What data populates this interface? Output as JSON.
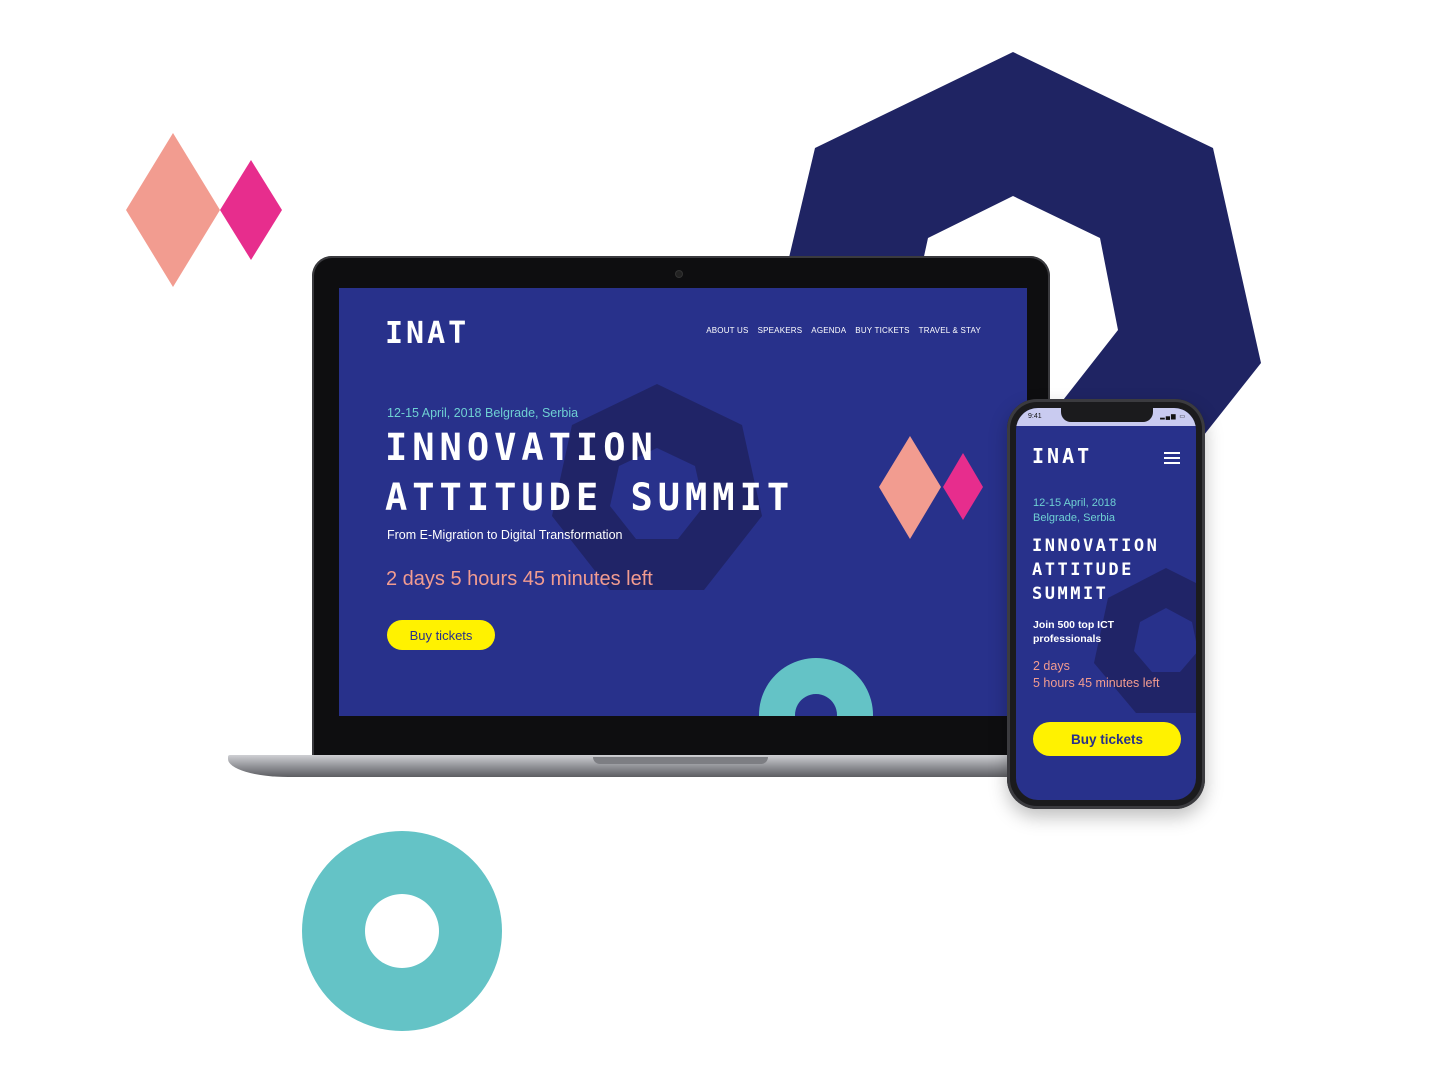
{
  "colors": {
    "navy": "#1f2463",
    "screen_bg": "#28318b",
    "salmon": "#f29c90",
    "magenta": "#e72d8d",
    "teal": "#64c3c6",
    "yellow": "#fff200",
    "cyan_text": "#6fd0d3"
  },
  "laptop": {
    "logo": "INAT",
    "nav": [
      "ABOUT US",
      "SPEAKERS",
      "AGENDA",
      "BUY TICKETS",
      "TRAVEL & STAY"
    ],
    "date": "12-15 April, 2018 Belgrade, Serbia",
    "headline_line1": "INNOVATION",
    "headline_line2": "ATTITUDE SUMMIT",
    "subtitle": "From E-Migration to Digital Transformation",
    "countdown": "2 days 5 hours 45 minutes left",
    "cta": "Buy tickets"
  },
  "phone": {
    "time": "9:41",
    "logo": "INAT",
    "date_line1": "12-15 April, 2018",
    "date_line2": "Belgrade, Serbia",
    "headline": [
      "INNOVATION",
      "ATTITUDE",
      "SUMMIT"
    ],
    "subtitle_line1": "Join 500 top ICT",
    "subtitle_line2": "professionals",
    "countdown_line1": "2 days",
    "countdown_line2": "5 hours 45 minutes left",
    "cta": "Buy tickets",
    "menu_icon": "hamburger-menu-icon"
  },
  "decor": {
    "shapes": [
      "navy-heptagon-ring",
      "salmon-diamond",
      "magenta-diamond",
      "teal-ring"
    ]
  }
}
